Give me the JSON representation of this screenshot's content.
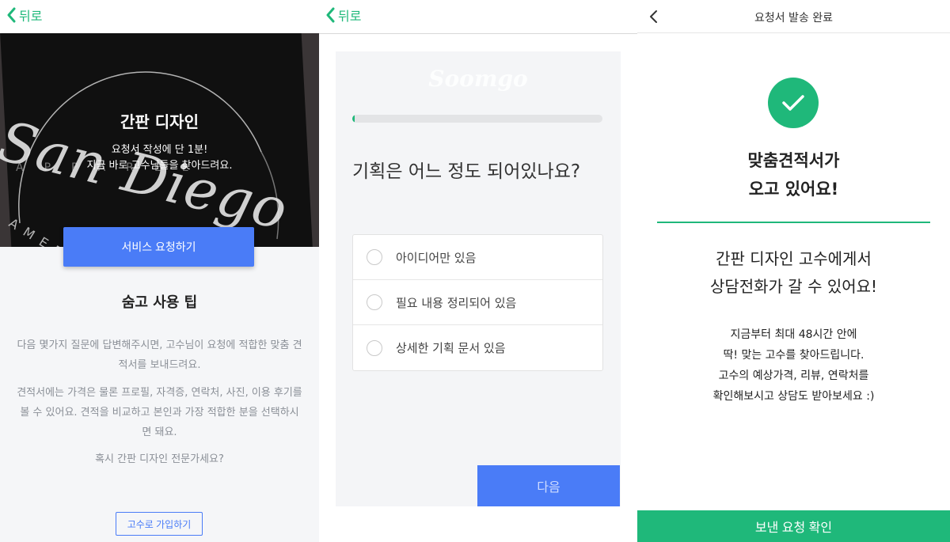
{
  "colors": {
    "green": "#1fb87a",
    "blue": "#4a7cf7"
  },
  "screen1": {
    "back_label": "뒤로",
    "hero": {
      "title": "간판 디자인",
      "subtitle_line1": "요청서 작성에 단 1분!",
      "subtitle_line2": "지금 바로 고수님들을 찾아드려요.",
      "image_text_script": "San Diego",
      "image_text_apparel": "APPAREL",
      "image_text_ame": "AMER"
    },
    "request_button": "서비스 요청하기",
    "tips": {
      "title": "숨고 사용 팁",
      "p1": "다음 몇가지 질문에 답변해주시면, 고수님이 요청에 적합한 맞춤 견적서를 보내드려요.",
      "p2": "견적서에는 가격은 물론 프로필, 자격증, 연락처, 사진, 이용 후기를 볼 수 있어요. 견적을 비교하고 본인과 가장 적합한 분을 선택하시면 돼요.",
      "p3": "혹시 간판 디자인 전문가세요?"
    },
    "join_button": "고수로 가입하기"
  },
  "screen2": {
    "back_label": "뒤로",
    "logo": "Soomgo",
    "progress": 0.01,
    "question": "기획은 어느 정도 되어있나요?",
    "options": [
      {
        "label": "아이디어만 있음"
      },
      {
        "label": "필요 내용 정리되어 있음"
      },
      {
        "label": "상세한 기획 문서 있음"
      }
    ],
    "next_button": "다음"
  },
  "screen3": {
    "title": "요청서 발송 완료",
    "headline_line1": "맞춤견적서가",
    "headline_line2": "오고 있어요!",
    "message_line1": "간판 디자인 고수에게서",
    "message_line2": "상담전화가 갈 수 있어요!",
    "info_line1": "지금부터 최대 48시간 안에",
    "info_line2": "딱! 맞는 고수를 찾아드립니다.",
    "info_line3": "고수의 예상가격, 리뷰, 연락처를",
    "info_line4": "확인해보시고 상담도 받아보세요 :)",
    "confirm_button": "보낸 요청 확인"
  }
}
